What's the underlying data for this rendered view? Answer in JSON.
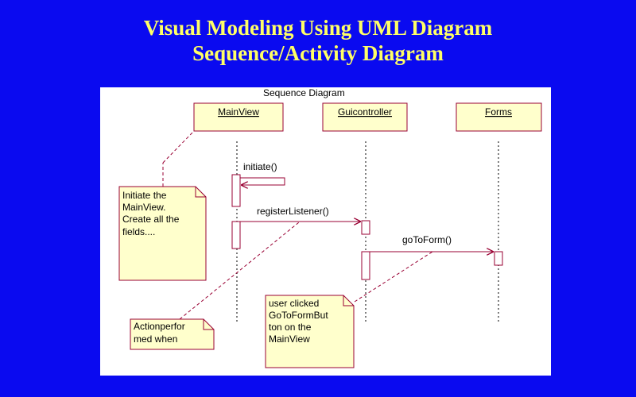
{
  "slide": {
    "title_line_1": "Visual Modeling Using UML Diagram",
    "title_line_2": "Sequence/Activity Diagram"
  },
  "diagram": {
    "name": "Sequence Diagram",
    "lifelines": [
      "MainView",
      "Guicontroller",
      "Forms"
    ],
    "messages": [
      "initiate()",
      "registerListener()",
      "goToForm()"
    ],
    "notes": {
      "note1": [
        "Initiate the",
        "MainView.",
        "Create all the",
        "fields...."
      ],
      "note2": [
        "Actionperfor",
        "med when"
      ],
      "note3": [
        "user clicked",
        "GoToFormBut",
        "ton on the",
        "MainView"
      ]
    }
  },
  "colors": {
    "background": "#0a0af0",
    "title": "#ffff66",
    "box_fill": "#ffffcc",
    "box_stroke": "#990033",
    "message_line": "#990033"
  }
}
